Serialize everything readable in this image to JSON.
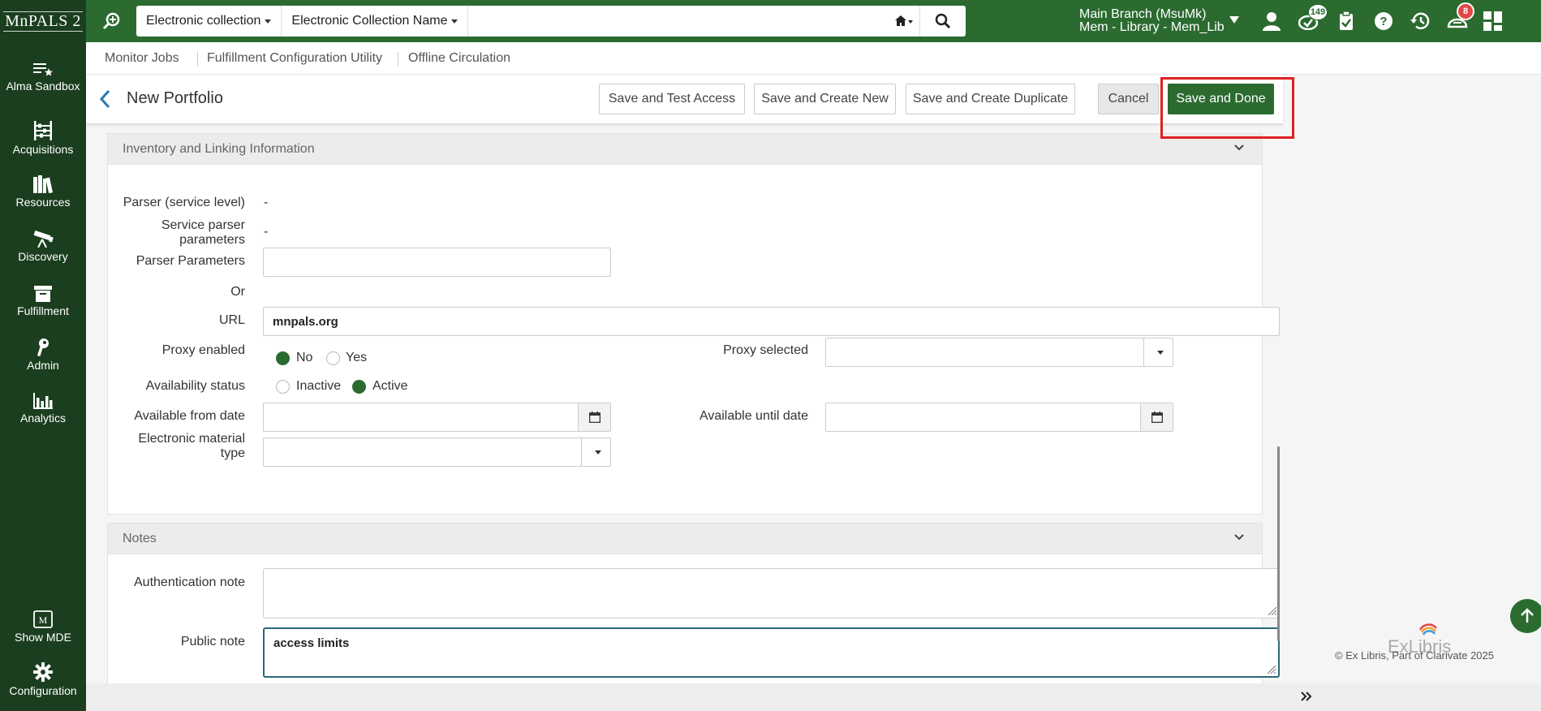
{
  "app": {
    "logo_text": "MnPALS 2"
  },
  "search": {
    "scope_label": "Electronic collection",
    "field_label": "Electronic Collection Name",
    "query": "",
    "placeholder": ""
  },
  "institution": {
    "line1": "Main Branch (MsuMk)",
    "line2": "Mem - Library - Mem_Lib"
  },
  "top_icons": {
    "tasks_badge": "149",
    "notifications_badge": "8"
  },
  "left_nav": {
    "items": [
      {
        "label": "Alma Sandbox",
        "icon": "list-star-icon"
      },
      {
        "label": "Acquisitions",
        "icon": "abacus-icon"
      },
      {
        "label": "Resources",
        "icon": "books-icon"
      },
      {
        "label": "Discovery",
        "icon": "telescope-icon"
      },
      {
        "label": "Fulfillment",
        "icon": "archive-box-icon"
      },
      {
        "label": "Admin",
        "icon": "key-icon"
      },
      {
        "label": "Analytics",
        "icon": "bar-chart-icon"
      }
    ],
    "bottom": [
      {
        "label": "Show MDE",
        "icon": "mde-icon"
      },
      {
        "label": "Configuration",
        "icon": "gear-icon"
      }
    ]
  },
  "sub_nav": {
    "links": [
      "Monitor Jobs",
      "Fulfillment Configuration Utility",
      "Offline Circulation"
    ]
  },
  "header": {
    "title": "New Portfolio",
    "buttons": {
      "save_test": "Save and Test Access",
      "save_new": "Save and Create New",
      "save_duplicate": "Save and Create Duplicate",
      "cancel": "Cancel",
      "save_done": "Save and Done"
    }
  },
  "inventory": {
    "title": "Inventory and Linking Information",
    "parser_service_label": "Parser (service level)",
    "parser_service_value": "-",
    "service_parser_params_label_1": "Service parser",
    "service_parser_params_label_2": "parameters",
    "service_parser_params_value": "-",
    "parser_params_label": "Parser Parameters",
    "parser_params_value": "",
    "or_label": "Or",
    "url_label": "URL",
    "url_value": "mnpals.org",
    "proxy_enabled_label": "Proxy enabled",
    "proxy_no": "No",
    "proxy_yes": "Yes",
    "proxy_selected_label": "Proxy selected",
    "proxy_selected_value": "",
    "availability_label": "Availability status",
    "availability_inactive": "Inactive",
    "availability_active": "Active",
    "available_from_label": "Available from date",
    "available_from_value": "",
    "available_until_label": "Available until date",
    "available_until_value": "",
    "material_type_label_1": "Electronic material",
    "material_type_label_2": "type",
    "material_type_value": ""
  },
  "notes": {
    "title": "Notes",
    "auth_note_label": "Authentication note",
    "auth_note_value": "",
    "public_note_label": "Public note",
    "public_note_value": "access limits"
  },
  "footer": {
    "vendor_logo": "ExLibris",
    "copyright": "© Ex Libris, Part of Clarivate   2025"
  },
  "colors": {
    "brand_green": "#2b6b30",
    "nav_dark": "#1b3e1f",
    "highlight_red": "#e02020"
  }
}
